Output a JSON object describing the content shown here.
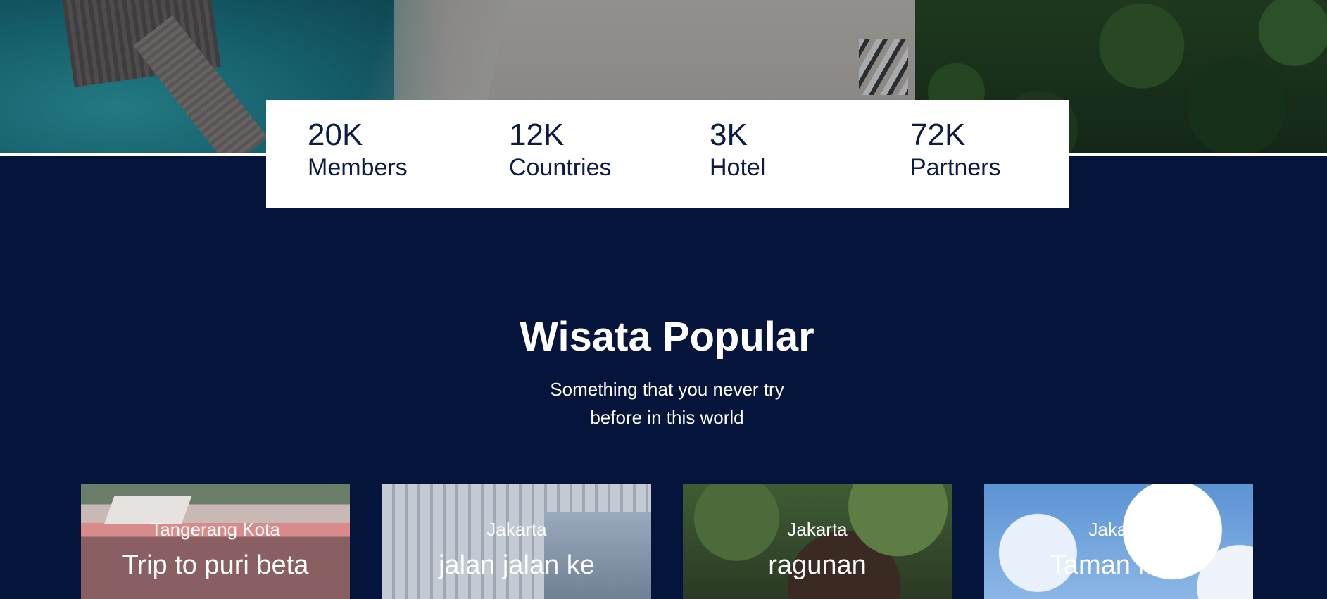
{
  "stats": [
    {
      "value": "20K",
      "label": "Members"
    },
    {
      "value": "12K",
      "label": "Countries"
    },
    {
      "value": "3K",
      "label": "Hotel"
    },
    {
      "value": "72K",
      "label": "Partners"
    }
  ],
  "popular": {
    "title": "Wisata Popular",
    "subtitle_line1": "Something that you never try",
    "subtitle_line2": "before in this world"
  },
  "destinations": [
    {
      "location": "Tangerang Kota",
      "name": "Trip to puri beta"
    },
    {
      "location": "Jakarta",
      "name": "jalan jalan ke"
    },
    {
      "location": "Jakarta",
      "name": "ragunan"
    },
    {
      "location": "Jakarta",
      "name": "Taman mini"
    }
  ],
  "colors": {
    "background": "#05143a",
    "stat_text": "#0b1b45",
    "card_text": "#ffffff"
  }
}
